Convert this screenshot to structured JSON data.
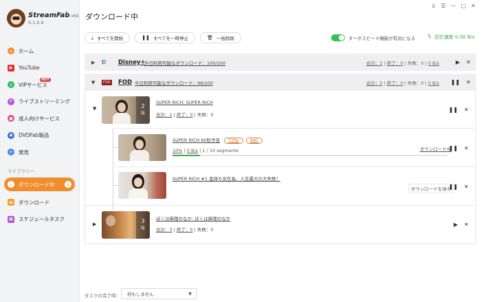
{
  "brand": {
    "name": "StreamFab",
    "arch": "x64",
    "version": "0.1.0.9"
  },
  "nav": {
    "items": [
      {
        "label": "ホーム",
        "icon": "home-icon",
        "color": "#f08e2e"
      },
      {
        "label": "YouTube",
        "icon": "youtube-icon",
        "color": "#e0322f"
      },
      {
        "label": "VIPサービス",
        "icon": "vip-key-icon",
        "color": "#2fbf5c",
        "badge": "HOT"
      },
      {
        "label": "ライブストリーミング",
        "icon": "live-icon",
        "color": "#b455d6"
      },
      {
        "label": "成人向けサービス",
        "icon": "adult-icon",
        "color": "#e0507a"
      },
      {
        "label": "DVDFab製品",
        "icon": "dvdfab-icon",
        "color": "#3a6fd8"
      },
      {
        "label": "発見",
        "icon": "discover-icon",
        "color": "#4a8be0"
      }
    ],
    "library_label": "ライブラリー",
    "library": [
      {
        "label": "ダウンロード中",
        "icon": "downloading-icon",
        "color": "#f08e2e",
        "active": true
      },
      {
        "label": "ダウンロード",
        "icon": "folder-icon",
        "color": "#f0a22e"
      },
      {
        "label": "スケジュールタスク",
        "icon": "schedule-icon",
        "color": "#b455d6"
      }
    ]
  },
  "header": {
    "title": "ダウンロード中"
  },
  "toolbar": {
    "start_all": "すべてを開始",
    "pause_all": "すべてを一時停止",
    "delete_all": "一括削除",
    "turbo_label": "ターボスピード機能が有効になる",
    "total_speed": "合計速度 0.00 B/s"
  },
  "groups": {
    "disney": {
      "name": "Disney+",
      "quota": "今日利用可能なダウンロード：100/100",
      "total": "合計：2",
      "done": "終了：0",
      "fail": "失敗：0",
      "speed": "0 B/s"
    },
    "fod": {
      "name": "FOD",
      "quota": "今日利用可能なダウンロード：96/100",
      "total": "合計：5",
      "done": "終了：0",
      "fail": "失敗：0",
      "speed": "0 B/s"
    }
  },
  "items": {
    "series1": {
      "title": "SUPER RICH: SUPER RICH",
      "count": "2",
      "count_unit": "話",
      "total": "合計：2",
      "done": "終了：0",
      "fail": "失敗：0"
    },
    "ep1": {
      "title": "SUPER RICH 60秒予告",
      "tag_quality": "720p",
      "tag_audio": "AAC",
      "percent": "10%",
      "speed": "0 B/s",
      "segments": "1 / 10 segments",
      "status": "ダウンロード中",
      "progress": 0.1
    },
    "ep2": {
      "title": "SUPER RICH #1 金持ち女社長、人生最大の大失敗！",
      "status": "ダウンロードを待ち"
    },
    "series2": {
      "title": "ぼくは麻理のなか: ぼくは麻理のなか",
      "count": "3",
      "count_unit": "話",
      "total": "合計：3",
      "done": "終了：0",
      "fail": "失敗：0"
    }
  },
  "footer": {
    "label": "タスクの完了時：",
    "select_value": "何もしません"
  }
}
